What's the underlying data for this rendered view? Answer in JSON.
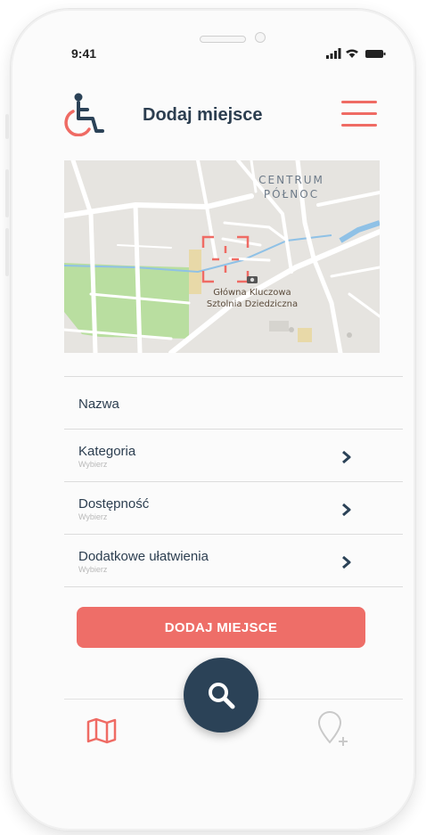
{
  "status_bar": {
    "time": "9:41"
  },
  "header": {
    "title": "Dodaj miejsce"
  },
  "map": {
    "district_line1": "CENTRUM",
    "district_line2": "PÓŁNOC",
    "place_line1": "Główna Kluczowa",
    "place_line2": "Sztolnia Dziedziczna"
  },
  "form": {
    "name_label": "Nazwa",
    "fields": [
      {
        "label": "Kategoria",
        "hint": "Wybierz"
      },
      {
        "label": "Dostępność",
        "hint": "Wybierz"
      },
      {
        "label": "Dodatkowe ułatwienia",
        "hint": "Wybierz"
      }
    ]
  },
  "cta": {
    "label": "DODAJ MIEJSCE"
  },
  "colors": {
    "accent": "#ee6e68",
    "dark": "#2b4257",
    "text": "#2c3e50"
  },
  "icons": [
    "wheelchair-icon",
    "menu-icon",
    "crosshair-icon",
    "chevron-right-icon",
    "search-icon",
    "map-icon",
    "add-place-icon"
  ]
}
